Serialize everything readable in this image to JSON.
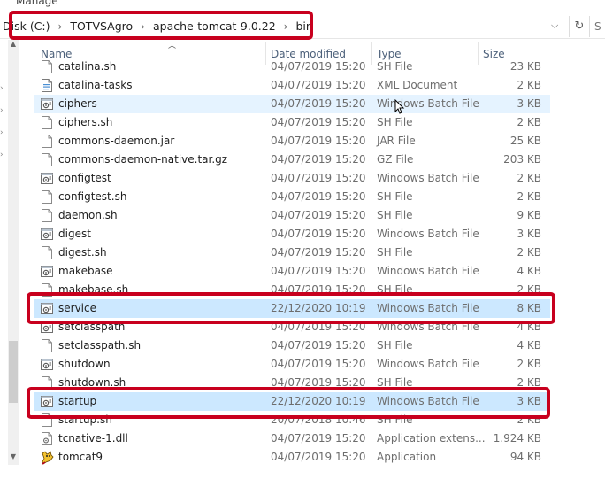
{
  "ribbon": {
    "manage_label": "Manage"
  },
  "breadcrumb": {
    "items": [
      "Disk (C:)",
      "TOTVSAgro",
      "apache-tomcat-9.0.22",
      "bin"
    ],
    "separator": "›"
  },
  "address_controls": {
    "dropdown_glyph": "⌵",
    "refresh_glyph": "↻",
    "search_glyph": "S"
  },
  "columns": {
    "name": "Name",
    "date": "Date modified",
    "type": "Type",
    "size": "Size"
  },
  "files": [
    {
      "name": "catalina.sh",
      "date": "04/07/2019 15:20",
      "type": "SH File",
      "size": "23 KB",
      "icon": "sh-file-icon"
    },
    {
      "name": "catalina-tasks",
      "date": "04/07/2019 15:20",
      "type": "XML Document",
      "size": "2 KB",
      "icon": "xml-file-icon"
    },
    {
      "name": "ciphers",
      "date": "04/07/2019 15:20",
      "type": "Windows Batch File",
      "size": "3 KB",
      "icon": "batch-file-icon",
      "state": "hover"
    },
    {
      "name": "ciphers.sh",
      "date": "04/07/2019 15:20",
      "type": "SH File",
      "size": "2 KB",
      "icon": "sh-file-icon"
    },
    {
      "name": "commons-daemon.jar",
      "date": "04/07/2019 15:20",
      "type": "JAR File",
      "size": "25 KB",
      "icon": "jar-file-icon"
    },
    {
      "name": "commons-daemon-native.tar.gz",
      "date": "04/07/2019 15:20",
      "type": "GZ File",
      "size": "203 KB",
      "icon": "gz-file-icon"
    },
    {
      "name": "configtest",
      "date": "04/07/2019 15:20",
      "type": "Windows Batch File",
      "size": "2 KB",
      "icon": "batch-file-icon"
    },
    {
      "name": "configtest.sh",
      "date": "04/07/2019 15:20",
      "type": "SH File",
      "size": "2 KB",
      "icon": "sh-file-icon"
    },
    {
      "name": "daemon.sh",
      "date": "04/07/2019 15:20",
      "type": "SH File",
      "size": "9 KB",
      "icon": "sh-file-icon"
    },
    {
      "name": "digest",
      "date": "04/07/2019 15:20",
      "type": "Windows Batch File",
      "size": "3 KB",
      "icon": "batch-file-icon"
    },
    {
      "name": "digest.sh",
      "date": "04/07/2019 15:20",
      "type": "SH File",
      "size": "2 KB",
      "icon": "sh-file-icon"
    },
    {
      "name": "makebase",
      "date": "04/07/2019 15:20",
      "type": "Windows Batch File",
      "size": "4 KB",
      "icon": "batch-file-icon"
    },
    {
      "name": "makebase.sh",
      "date": "04/07/2019 15:20",
      "type": "SH File",
      "size": "2 KB",
      "icon": "sh-file-icon"
    },
    {
      "name": "service",
      "date": "22/12/2020 10:19",
      "type": "Windows Batch File",
      "size": "8 KB",
      "icon": "batch-file-icon",
      "state": "selected"
    },
    {
      "name": "setclasspath",
      "date": "04/07/2019 15:20",
      "type": "Windows Batch File",
      "size": "4 KB",
      "icon": "batch-file-icon"
    },
    {
      "name": "setclasspath.sh",
      "date": "04/07/2019 15:20",
      "type": "SH File",
      "size": "4 KB",
      "icon": "sh-file-icon"
    },
    {
      "name": "shutdown",
      "date": "04/07/2019 15:20",
      "type": "Windows Batch File",
      "size": "2 KB",
      "icon": "batch-file-icon"
    },
    {
      "name": "shutdown.sh",
      "date": "04/07/2019 15:20",
      "type": "SH File",
      "size": "2 KB",
      "icon": "sh-file-icon"
    },
    {
      "name": "startup",
      "date": "22/12/2020 10:19",
      "type": "Windows Batch File",
      "size": "3 KB",
      "icon": "batch-file-icon",
      "state": "selected"
    },
    {
      "name": "startup.sh",
      "date": "20/07/2018 10:46",
      "type": "SH File",
      "size": "2 KB",
      "icon": "sh-file-icon"
    },
    {
      "name": "tcnative-1.dll",
      "date": "04/07/2019 15:20",
      "type": "Application extens...",
      "size": "1.924 KB",
      "icon": "dll-file-icon"
    },
    {
      "name": "tomcat9",
      "date": "04/07/2019 15:20",
      "type": "Application",
      "size": "94 KB",
      "icon": "tomcat-app-icon"
    }
  ],
  "colors": {
    "highlight_box": "#c8001e",
    "selected_row": "#cce8ff",
    "hover_row": "#e5f3ff",
    "header_text": "#4c607a"
  }
}
